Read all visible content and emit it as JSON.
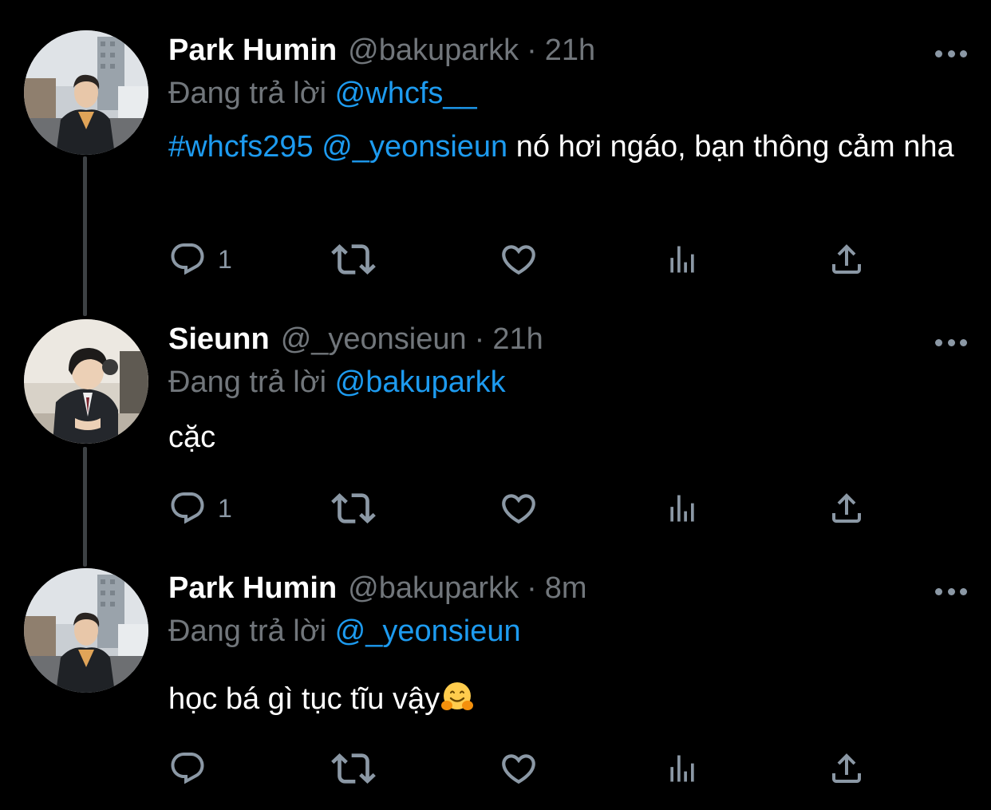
{
  "tweets": [
    {
      "display_name": "Park Humin",
      "handle": "@bakuparkk",
      "dot": "·",
      "time": "21h",
      "reply_prefix": "Đang trả lời",
      "reply_to": "@whcfs__",
      "hashtag": "#whcfs295",
      "mention": "@_yeonsieun",
      "text": "nó hơi ngáo, bạn thông cảm nha",
      "reply_count": "1",
      "avatar_icon": "avatar-park-humin"
    },
    {
      "display_name": "Sieunn",
      "handle": "@_yeonsieun",
      "dot": "·",
      "time": "21h",
      "reply_prefix": "Đang trả lời",
      "reply_to": "@bakuparkk",
      "text": "cặc",
      "reply_count": "1",
      "avatar_icon": "avatar-sieunn"
    },
    {
      "display_name": "Park Humin",
      "handle": "@bakuparkk",
      "dot": "·",
      "time": "8m",
      "reply_prefix": "Đang trả lời",
      "reply_to": "@_yeonsieun",
      "text": "học bá gì tục tĩu vậy",
      "emoji": "hugging-face-emoji",
      "reply_count": "",
      "avatar_icon": "avatar-park-humin"
    }
  ],
  "icons": {
    "reply": "reply-icon",
    "retweet": "retweet-icon",
    "like": "like-icon",
    "views": "views-icon",
    "share": "share-icon",
    "more": "more-icon"
  },
  "colors": {
    "background": "#000000",
    "link": "#1d9bf0",
    "secondary_text": "#71767b",
    "icon": "#8b98a5",
    "thread_line": "#3d4144"
  }
}
